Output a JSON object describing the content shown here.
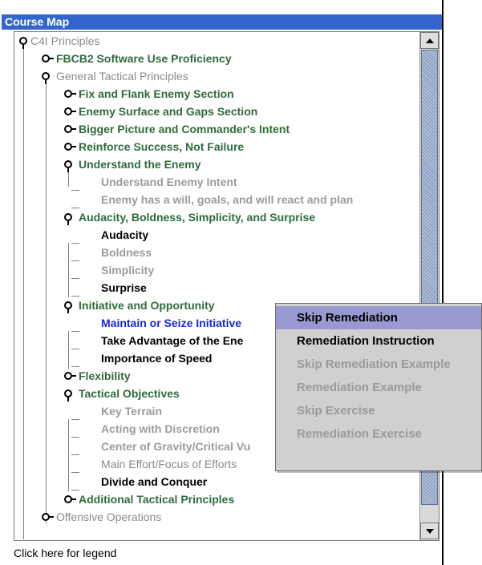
{
  "window": {
    "title": "Course Map"
  },
  "footer": {
    "legend_link": "Click here for legend"
  },
  "tree": {
    "root": "C4I Principles",
    "fbcb2": "FBCB2 Software Use Proficiency",
    "gtp": "General Tactical Principles",
    "fix_flank": "Fix and Flank Enemy Section",
    "surface_gaps": "Enemy Surface and Gaps Section",
    "bigger_picture": "Bigger Picture and Commander's Intent",
    "reinforce": "Reinforce Success, Not Failure",
    "understand_enemy": "Understand the Enemy",
    "understand_intent": "Understand Enemy Intent",
    "enemy_will": "Enemy has a will, goals, and will react and plan",
    "audacity_group": "Audacity, Boldness, Simplicity, and Surprise",
    "audacity": "Audacity",
    "boldness": "Boldness",
    "simplicity": "Simplicity",
    "surprise": "Surprise",
    "initiative": "Initiative and Opportunity",
    "maintain_initiative": "Maintain or Seize Initiative",
    "take_advantage": "Take Advantage of the Ene",
    "importance_speed": "Importance of Speed",
    "flexibility": "Flexibility",
    "tactical_objectives": "Tactical Objectives",
    "key_terrain": "Key Terrain",
    "discretion": "Acting with Discretion",
    "center_gravity": "Center of Gravity/Critical Vu",
    "main_effort": "Main Effort/Focus of Efforts",
    "divide_conquer": "Divide and Conquer",
    "additional": "Additional Tactical Principles",
    "offensive": "Offensive Operations"
  },
  "context_menu": {
    "items": [
      "Skip Remediation",
      "Remediation Instruction",
      "Skip Remediation Example",
      "Remediation Example",
      "Skip Exercise",
      "Remediation Exercise"
    ]
  },
  "colors": {
    "title_bar": "#3366cc",
    "green_node": "#2f6b3b",
    "grey_node": "#8a8a8a",
    "selected_node": "#1a27d6",
    "menu_highlight": "#9899d0"
  }
}
